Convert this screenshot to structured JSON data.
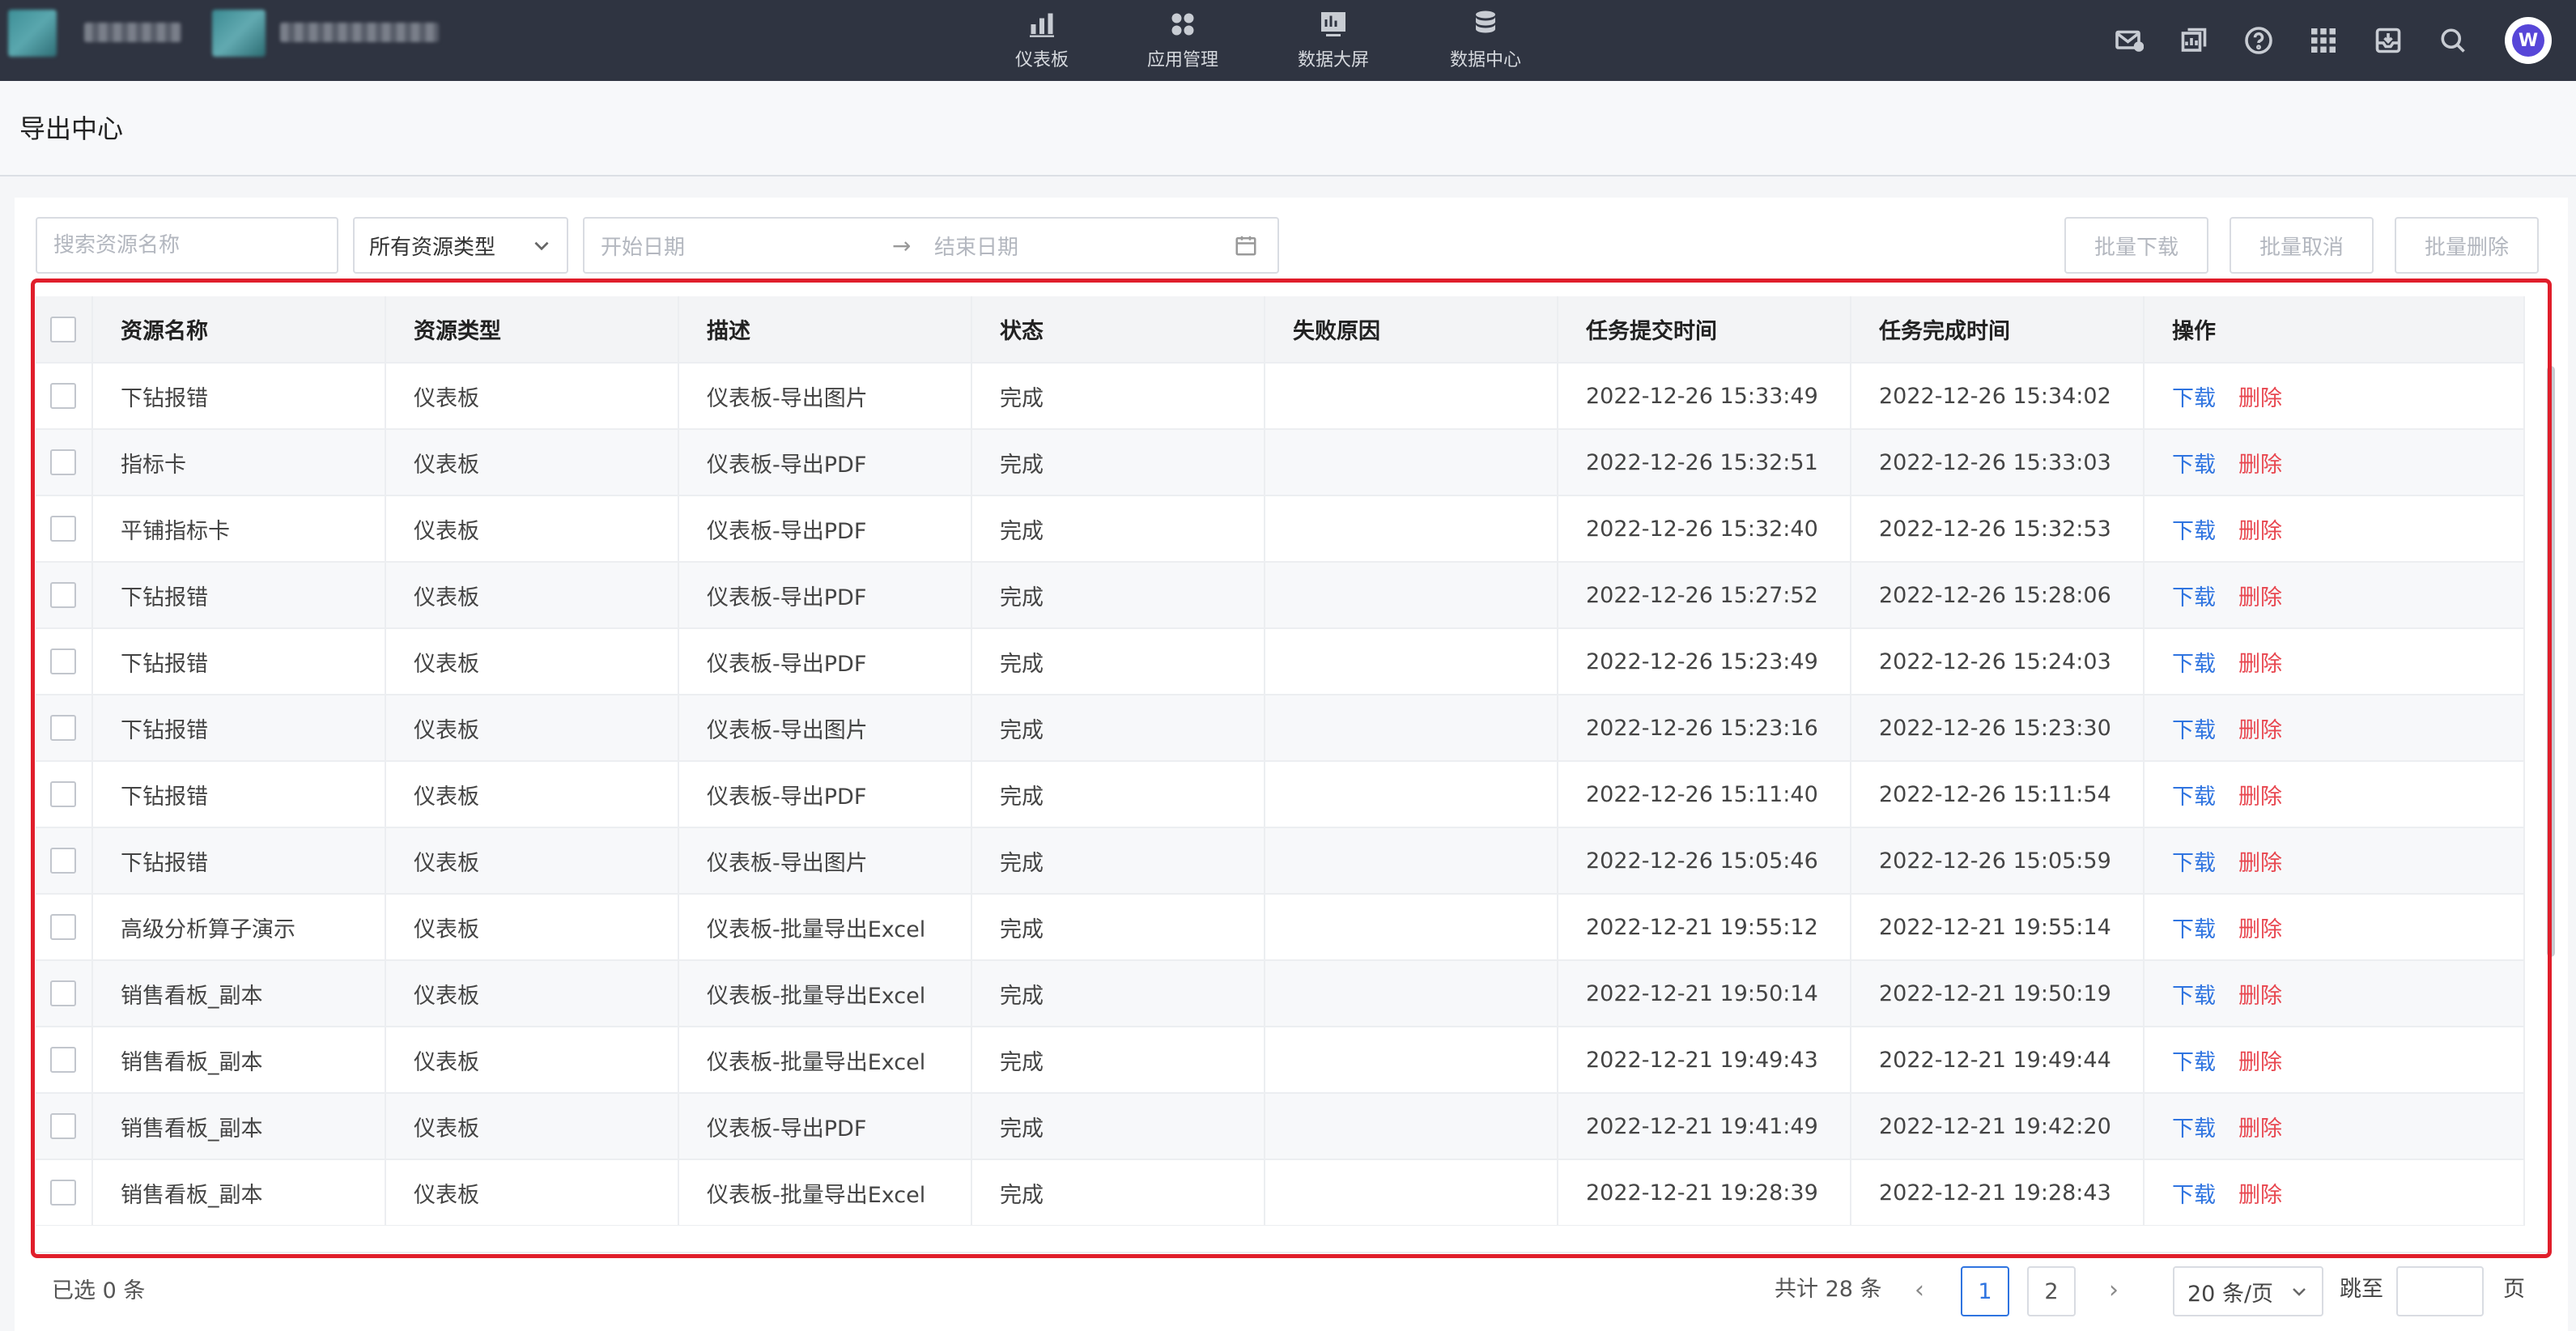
{
  "nav": {
    "tabs": [
      {
        "label": "仪表板",
        "icon": "bar-chart-icon"
      },
      {
        "label": "应用管理",
        "icon": "apps-grid-icon"
      },
      {
        "label": "数据大屏",
        "icon": "dashboard-screen-icon"
      },
      {
        "label": "数据中心",
        "icon": "database-icon"
      }
    ],
    "right_icons": [
      "mail-icon",
      "report-icon",
      "help-icon",
      "grid-menu-icon",
      "download-inbox-icon",
      "search-icon"
    ],
    "avatar_text": "W"
  },
  "page": {
    "title": "导出中心"
  },
  "filters": {
    "search_placeholder": "搜索资源名称",
    "type_select": "所有资源类型",
    "start_date_placeholder": "开始日期",
    "range_arrow": "→",
    "end_date_placeholder": "结束日期"
  },
  "batch_actions": {
    "download": "批量下载",
    "cancel": "批量取消",
    "delete": "批量删除"
  },
  "table": {
    "columns": [
      "资源名称",
      "资源类型",
      "描述",
      "状态",
      "失败原因",
      "任务提交时间",
      "任务完成时间",
      "操作"
    ],
    "action_download": "下载",
    "action_delete": "删除",
    "rows": [
      {
        "name": "下钻报错",
        "type": "仪表板",
        "desc": "仪表板-导出图片",
        "status": "完成",
        "reason": "",
        "submit": "2022-12-26 15:33:49",
        "finish": "2022-12-26 15:34:02"
      },
      {
        "name": "指标卡",
        "type": "仪表板",
        "desc": "仪表板-导出PDF",
        "status": "完成",
        "reason": "",
        "submit": "2022-12-26 15:32:51",
        "finish": "2022-12-26 15:33:03"
      },
      {
        "name": "平铺指标卡",
        "type": "仪表板",
        "desc": "仪表板-导出PDF",
        "status": "完成",
        "reason": "",
        "submit": "2022-12-26 15:32:40",
        "finish": "2022-12-26 15:32:53"
      },
      {
        "name": "下钻报错",
        "type": "仪表板",
        "desc": "仪表板-导出PDF",
        "status": "完成",
        "reason": "",
        "submit": "2022-12-26 15:27:52",
        "finish": "2022-12-26 15:28:06"
      },
      {
        "name": "下钻报错",
        "type": "仪表板",
        "desc": "仪表板-导出PDF",
        "status": "完成",
        "reason": "",
        "submit": "2022-12-26 15:23:49",
        "finish": "2022-12-26 15:24:03"
      },
      {
        "name": "下钻报错",
        "type": "仪表板",
        "desc": "仪表板-导出图片",
        "status": "完成",
        "reason": "",
        "submit": "2022-12-26 15:23:16",
        "finish": "2022-12-26 15:23:30"
      },
      {
        "name": "下钻报错",
        "type": "仪表板",
        "desc": "仪表板-导出PDF",
        "status": "完成",
        "reason": "",
        "submit": "2022-12-26 15:11:40",
        "finish": "2022-12-26 15:11:54"
      },
      {
        "name": "下钻报错",
        "type": "仪表板",
        "desc": "仪表板-导出图片",
        "status": "完成",
        "reason": "",
        "submit": "2022-12-26 15:05:46",
        "finish": "2022-12-26 15:05:59"
      },
      {
        "name": "高级分析算子演示",
        "type": "仪表板",
        "desc": "仪表板-批量导出Excel",
        "status": "完成",
        "reason": "",
        "submit": "2022-12-21 19:55:12",
        "finish": "2022-12-21 19:55:14"
      },
      {
        "name": "销售看板_副本",
        "type": "仪表板",
        "desc": "仪表板-批量导出Excel",
        "status": "完成",
        "reason": "",
        "submit": "2022-12-21 19:50:14",
        "finish": "2022-12-21 19:50:19"
      },
      {
        "name": "销售看板_副本",
        "type": "仪表板",
        "desc": "仪表板-批量导出Excel",
        "status": "完成",
        "reason": "",
        "submit": "2022-12-21 19:49:43",
        "finish": "2022-12-21 19:49:44"
      },
      {
        "name": "销售看板_副本",
        "type": "仪表板",
        "desc": "仪表板-导出PDF",
        "status": "完成",
        "reason": "",
        "submit": "2022-12-21 19:41:49",
        "finish": "2022-12-21 19:42:20"
      },
      {
        "name": "销售看板_副本",
        "type": "仪表板",
        "desc": "仪表板-批量导出Excel",
        "status": "完成",
        "reason": "",
        "submit": "2022-12-21 19:28:39",
        "finish": "2022-12-21 19:28:43"
      }
    ]
  },
  "footer": {
    "selected": "已选 0 条",
    "total": "共计 28 条",
    "prev": "‹",
    "next": "›",
    "pages": [
      "1",
      "2"
    ],
    "page_size": "20 条/页",
    "jump_label": "跳至",
    "page_unit": "页"
  },
  "colors": {
    "link": "#2f74e0",
    "danger": "#e8464f",
    "topbar": "#2f3441",
    "highlight_frame": "#e01e2b"
  }
}
